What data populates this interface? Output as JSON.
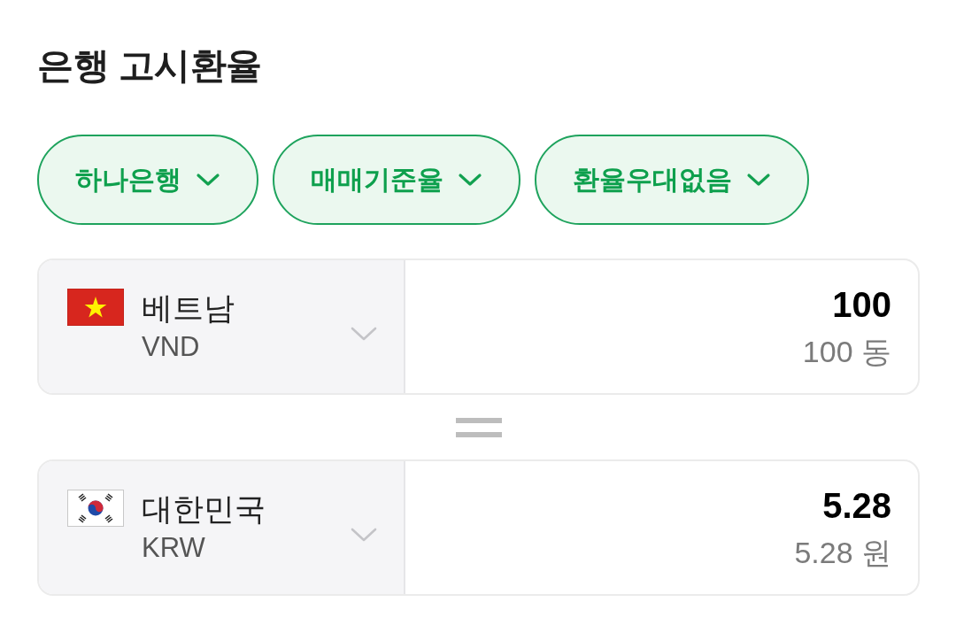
{
  "title": "은행 고시환율",
  "filters": [
    {
      "label": "하나은행"
    },
    {
      "label": "매매기준율"
    },
    {
      "label": "환율우대없음"
    }
  ],
  "currencies": [
    {
      "country": "베트남",
      "code": "VND",
      "amount": "100",
      "amount_text": "100 동"
    },
    {
      "country": "대한민국",
      "code": "KRW",
      "amount": "5.28",
      "amount_text": "5.28 원"
    }
  ]
}
